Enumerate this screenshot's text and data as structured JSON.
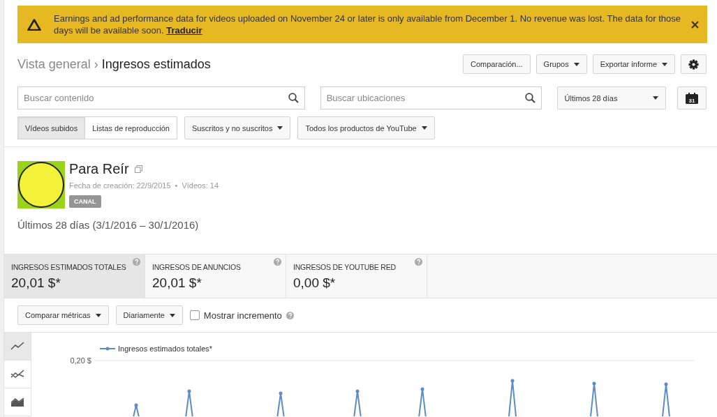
{
  "banner": {
    "message": "Earnings and ad performance data for videos uploaded on November 24 or later is only available from December 1. No revenue was lost. The data for those days will be available soon.",
    "link": "Traducir"
  },
  "breadcrumb": {
    "parent": "Vista general",
    "separator": "›",
    "current": "Ingresos estimados"
  },
  "header_buttons": [
    {
      "label": "Comparación...",
      "kind": "plain"
    },
    {
      "label": "Grupos",
      "kind": "dropdown"
    },
    {
      "label": "Exportar informe",
      "kind": "dropdown"
    }
  ],
  "search_content": {
    "placeholder": "Buscar contenido"
  },
  "search_locations": {
    "placeholder": "Buscar ubicaciones"
  },
  "date_range": {
    "value": "Últimos 28 días"
  },
  "calendar_day": "31",
  "content_tabs": [
    {
      "label": "Vídeos subidos",
      "selected": true
    },
    {
      "label": "Listas de reproducción",
      "selected": false
    }
  ],
  "filters": [
    {
      "label": "Suscritos y no suscritos"
    },
    {
      "label": "Todos los productos de YouTube"
    }
  ],
  "channel": {
    "name": "Para Reír",
    "created": "Fecha de creación: 22/9/2015",
    "separator": "•",
    "videos": "Vídeos: 14",
    "badge": "CANAL"
  },
  "period": "Últimos 28 días (3/1/2016 – 30/1/2016)",
  "metrics": [
    {
      "label": "INGRESOS ESTIMADOS TOTALES",
      "value": "20,01 $*",
      "selected": true
    },
    {
      "label": "INGRESOS DE ANUNCIOS",
      "value": "20,01 $*",
      "selected": false
    },
    {
      "label": "INGRESOS DE YOUTUBE RED",
      "value": "0,00 $*",
      "selected": false
    }
  ],
  "chart_controls": [
    {
      "label": "Comparar métricas"
    },
    {
      "label": "Diariamente"
    }
  ],
  "show_increment": {
    "label": "Mostrar incremento",
    "checked": false
  },
  "chart_types": [
    {
      "kind": "line",
      "selected": true
    },
    {
      "kind": "multiline",
      "selected": false
    },
    {
      "kind": "area",
      "selected": false
    }
  ],
  "chart": {
    "legend": "Ingresos estimados totales*",
    "y_label": "0,20 $"
  }
}
